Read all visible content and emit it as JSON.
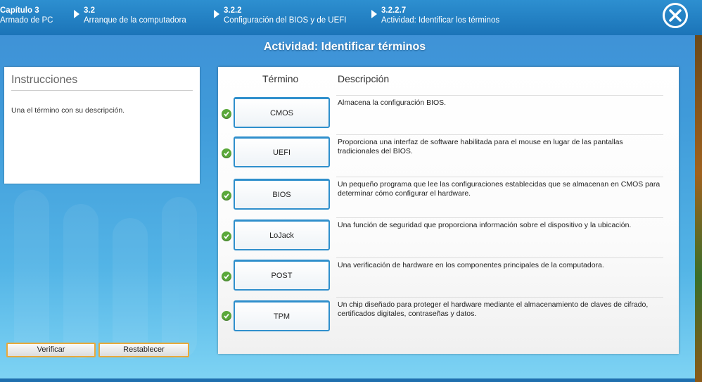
{
  "breadcrumbs": [
    {
      "num": "Capítulo 3",
      "label": "Armado de PC"
    },
    {
      "num": "3.2",
      "label": "Arranque de la computadora"
    },
    {
      "num": "3.2.2",
      "label": "Configuración del BIOS y de UEFI"
    },
    {
      "num": "3.2.2.7",
      "label": "Actividad: Identificar los términos"
    }
  ],
  "title": "Actividad: Identificar términos",
  "instructions": {
    "heading": "Instrucciones",
    "text": "Una el término con su descripción."
  },
  "table": {
    "term_header": "Término",
    "desc_header": "Descripción"
  },
  "rows": [
    {
      "term": "CMOS",
      "desc": "Almacena la configuración BIOS.",
      "status": "correct"
    },
    {
      "term": "UEFI",
      "desc": "Proporciona una interfaz de software habilitada para el mouse en lugar de las pantallas tradicionales del BIOS.",
      "status": "correct"
    },
    {
      "term": "BIOS",
      "desc": "Un pequeño programa que lee las configuraciones establecidas que se almacenan en CMOS para determinar cómo configurar el hardware.",
      "status": "correct"
    },
    {
      "term": "LoJack",
      "desc": "Una función de seguridad que proporciona información sobre el dispositivo y la ubicación.",
      "status": "correct"
    },
    {
      "term": "POST",
      "desc": "Una verificación de hardware en los componentes principales de la computadora.",
      "status": "correct"
    },
    {
      "term": "TPM",
      "desc": "Un chip diseñado para proteger el hardware mediante el almacenamiento de claves de cifrado, certificados digitales, contraseñas y datos.",
      "status": "correct"
    }
  ],
  "buttons": {
    "verify": "Verificar",
    "reset": "Restablecer"
  },
  "icons": {
    "close": "close-circle-icon",
    "check": "check-icon",
    "breadcrumb_arrow": "triangle-right-icon"
  },
  "colors": {
    "header": "#1b74b8",
    "accent_border": "#e8a93a",
    "term_border": "#2f8fcc",
    "check": "#5aa83a"
  }
}
